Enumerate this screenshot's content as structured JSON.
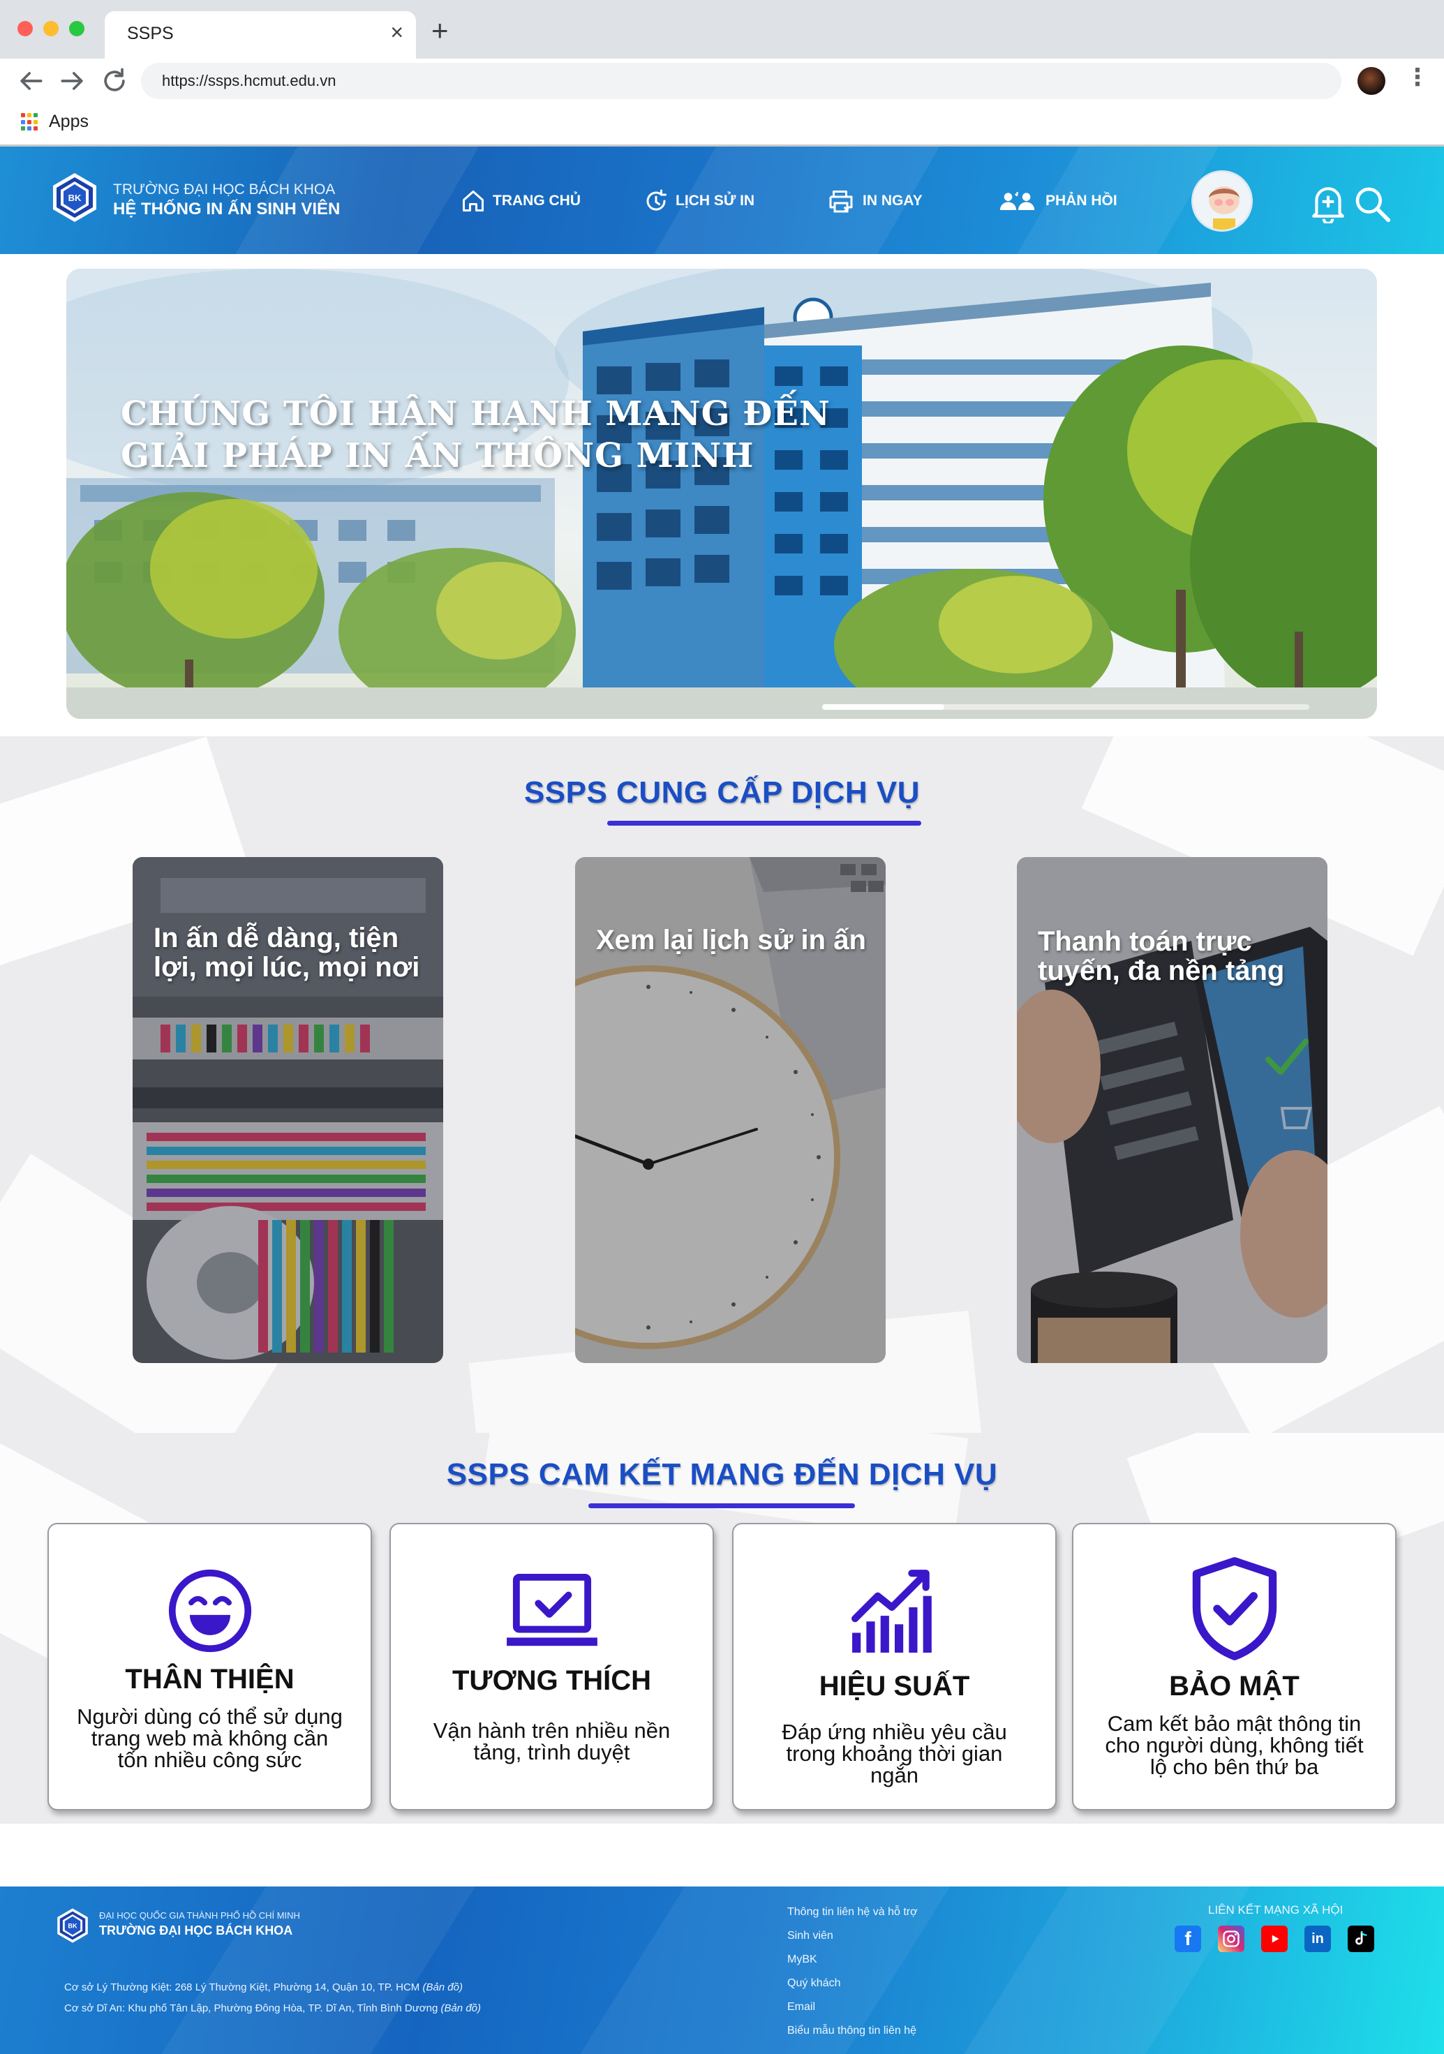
{
  "browser": {
    "tab_title": "SSPS",
    "close_glyph": "×",
    "new_tab_glyph": "+",
    "url": "https://ssps.hcmut.edu.vn",
    "bookmarks_label": "Apps",
    "kebab_glyph": "⋮"
  },
  "header": {
    "school_line1": "TRƯỜNG ĐẠI HỌC BÁCH KHOA",
    "school_line2": "HỆ THỐNG IN ẤN SINH VIÊN",
    "logo_text": "BK",
    "nav": [
      {
        "label": "TRANG CHỦ",
        "icon": "home-icon"
      },
      {
        "label": "LỊCH SỬ IN",
        "icon": "history-icon"
      },
      {
        "label": "IN NGAY",
        "icon": "printer-icon"
      },
      {
        "label": "PHẢN HỒI",
        "icon": "feedback-icon"
      }
    ],
    "accent": "#1762b8"
  },
  "hero": {
    "title_line1": "CHÚNG TÔI HÂN HẠNH MANG ĐẾN",
    "title_line2": "GIẢI PHÁP IN ẤN THÔNG MINH",
    "slide_progress": 0.25
  },
  "services": {
    "title": "SSPS CUNG CẤP DỊCH VỤ",
    "cards": [
      {
        "label": "In ấn dễ dàng, tiện lợi, mọi lúc, mọi nơi"
      },
      {
        "label": "Xem lại lịch sử in ấn"
      },
      {
        "label": "Thanh toán trực tuyến, đa nền tảng"
      }
    ]
  },
  "commitments": {
    "title": "SSPS CAM KẾT MANG ĐẾN DỊCH VỤ",
    "icon_color": "#3a17c9",
    "cards": [
      {
        "heading": "THÂN THIỆN",
        "desc": "Người dùng có thể sử dụng trang web mà không cần tốn nhiều công sức",
        "icon": "smile-icon"
      },
      {
        "heading": "TƯƠNG THÍCH",
        "desc": "Vận hành trên nhiều nền tảng, trình duyệt",
        "icon": "laptop-check-icon"
      },
      {
        "heading": "HIỆU SUẤT",
        "desc": "Đáp ứng nhiều yêu cầu trong khoảng thời gian ngắn",
        "icon": "performance-chart-icon"
      },
      {
        "heading": "BẢO MẬT",
        "desc": "Cam kết bảo mật thông tin cho người dùng, không tiết lộ cho bên thứ ba",
        "icon": "shield-check-icon"
      }
    ]
  },
  "footer": {
    "university": "ĐẠI HỌC QUỐC GIA THÀNH PHỐ HỒ CHÍ MINH",
    "school": "TRƯỜNG ĐẠI HỌC BÁCH KHOA",
    "logo_text": "BK",
    "address1": "Cơ sở Lý Thường Kiệt: 268 Lý Thường Kiệt, Phường 14, Quận 10, TP. HCM ",
    "address2": "Cơ sở Dĩ An: Khu phố Tân Lập, Phường Đông Hòa, TP. Dĩ An, Tỉnh Bình Dương ",
    "map_link": "(Bản đồ)",
    "links": [
      "Thông tin liên hệ và hỗ trợ",
      "Sinh viên",
      "MyBK",
      "Quý khách",
      "Email",
      "Biểu mẫu thông tin liên hệ"
    ],
    "social_title": "LIÊN KẾT MẠNG XÃ HỘI",
    "social": [
      {
        "name": "facebook-icon",
        "glyph": "f",
        "color": "#1877f2"
      },
      {
        "name": "instagram-icon",
        "glyph": "◎",
        "color": "#d62976"
      },
      {
        "name": "youtube-icon",
        "glyph": "▶",
        "color": "#ff0000"
      },
      {
        "name": "linkedin-icon",
        "glyph": "in",
        "color": "#0a66c2"
      },
      {
        "name": "tiktok-icon",
        "glyph": "♪",
        "color": "#000000"
      }
    ]
  }
}
